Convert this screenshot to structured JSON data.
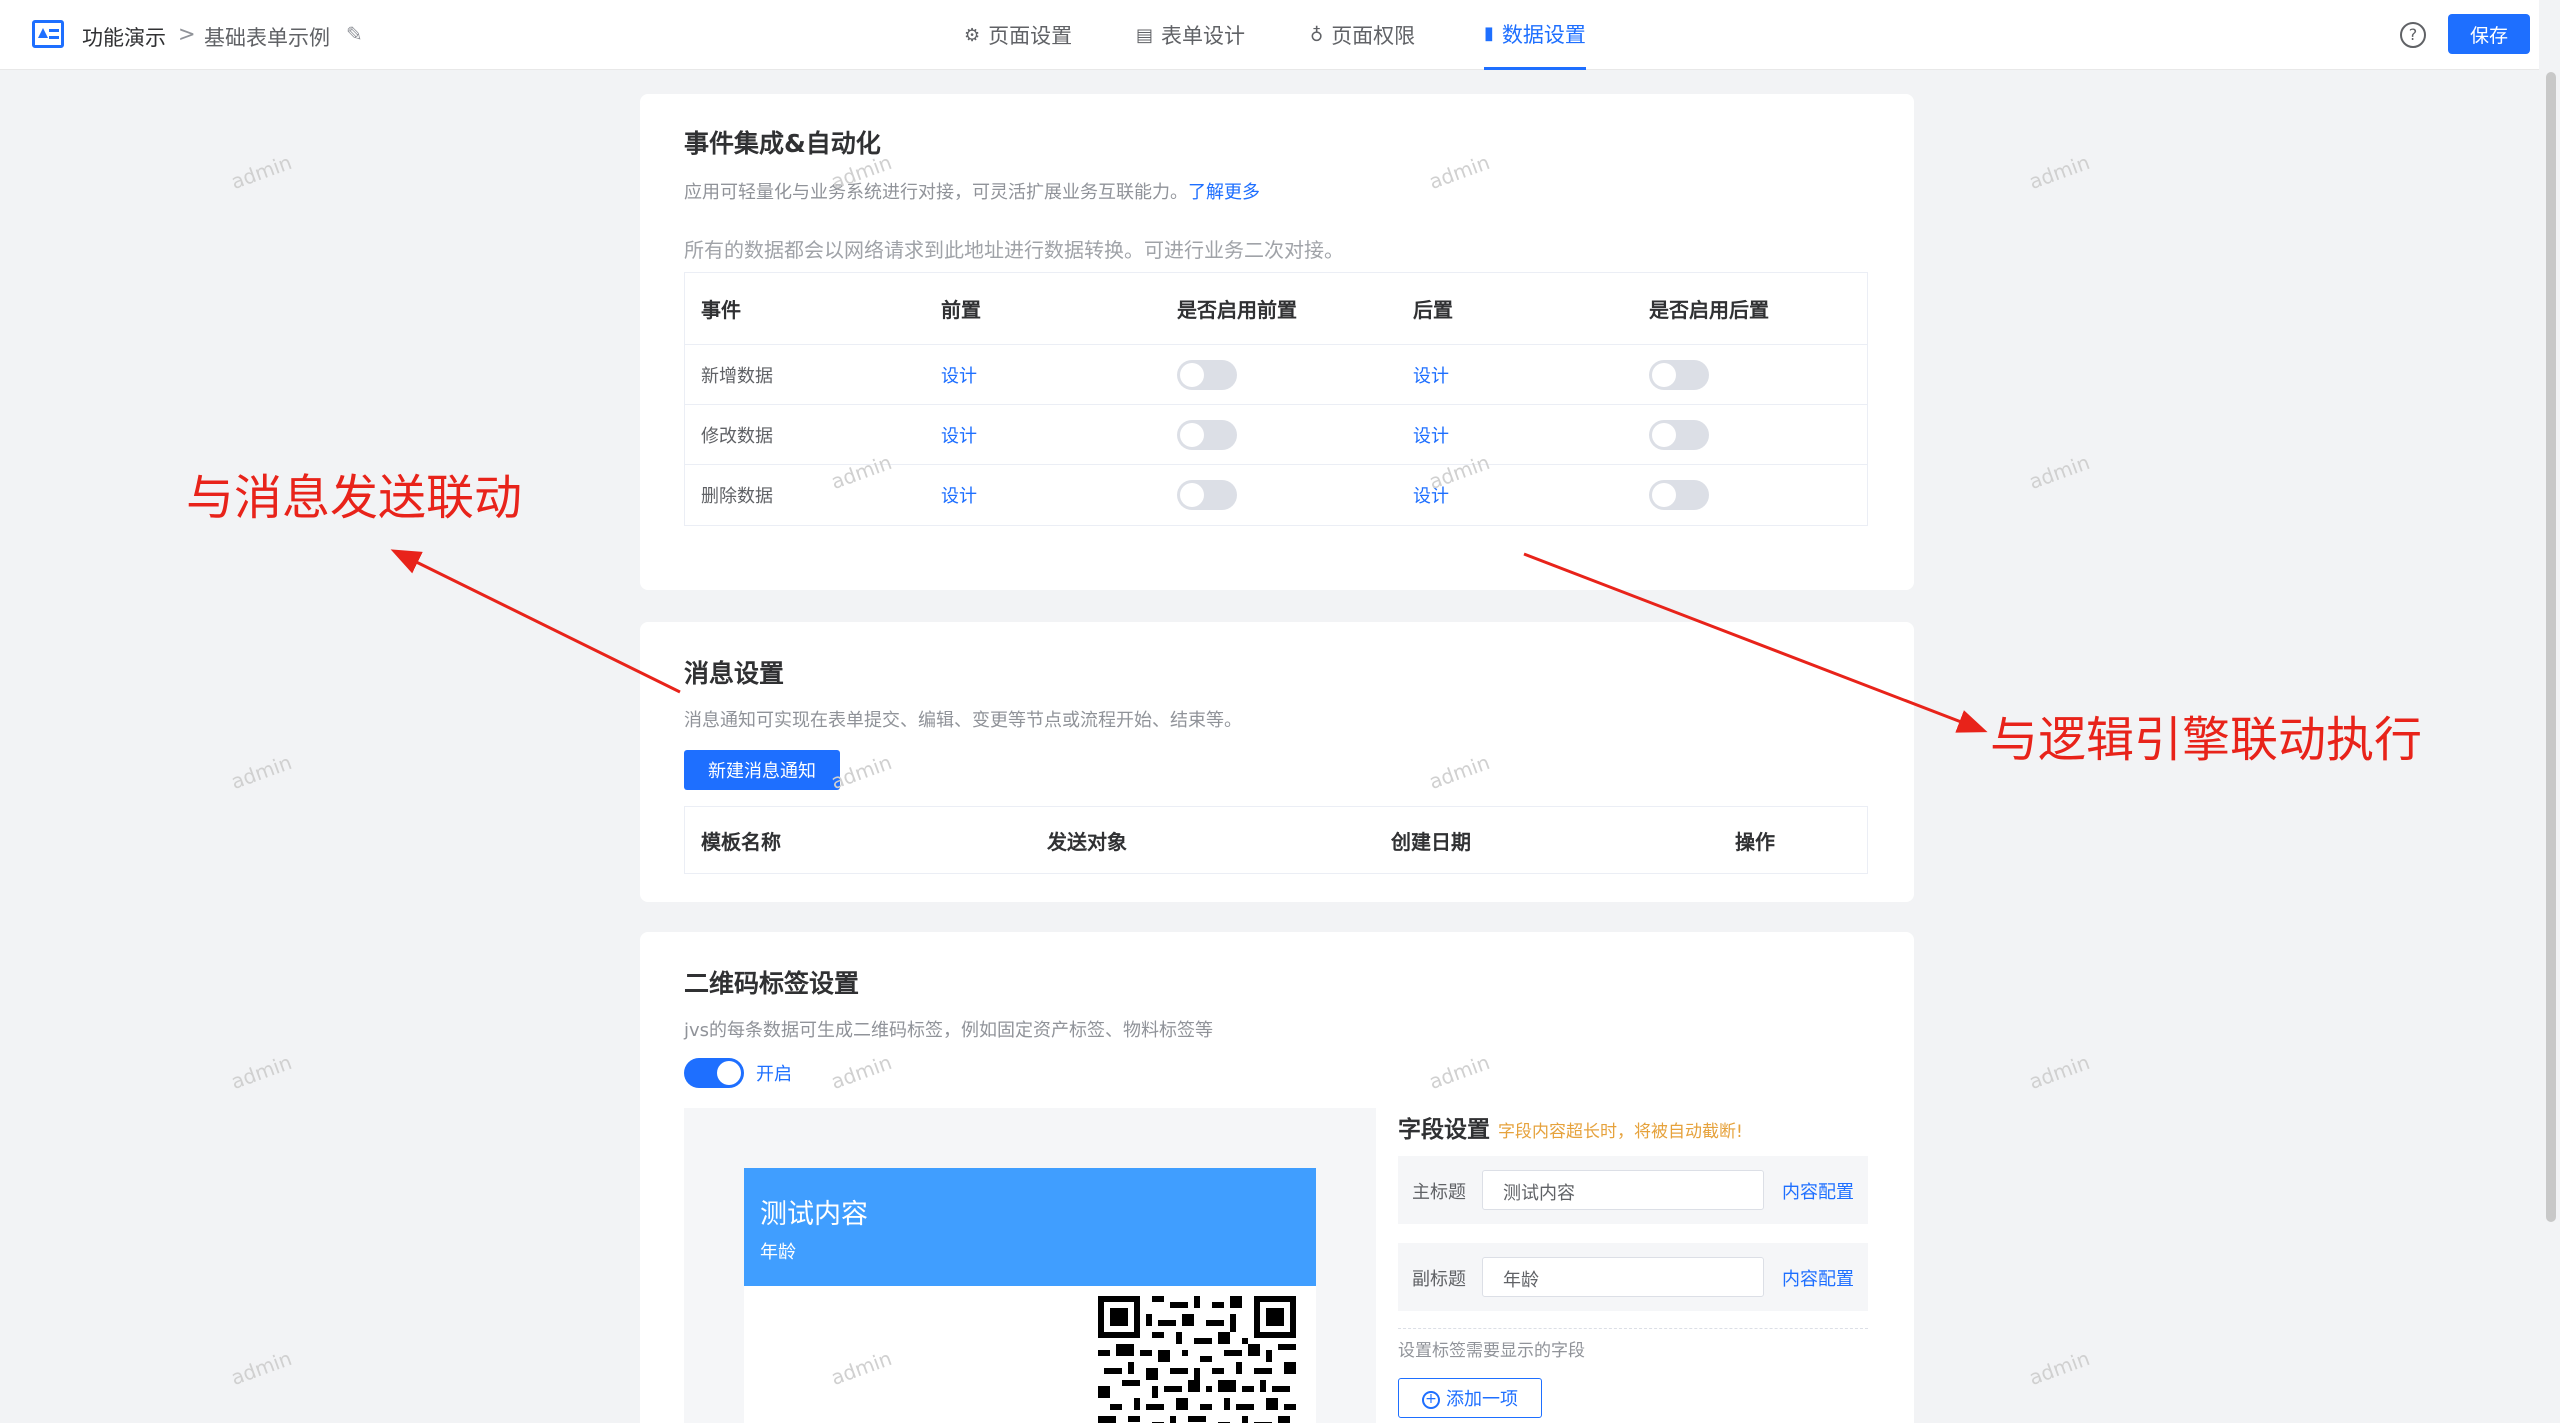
{
  "header": {
    "app_name": "功能演示",
    "separator": ">",
    "page_name": "基础表单示例",
    "tabs": [
      {
        "label": "页面设置",
        "icon": "gear-icon"
      },
      {
        "label": "表单设计",
        "icon": "document-icon"
      },
      {
        "label": "页面权限",
        "icon": "lock-icon"
      },
      {
        "label": "数据设置",
        "icon": "bar-chart-icon",
        "active": true
      }
    ],
    "help_symbol": "?",
    "save_label": "保存"
  },
  "events_card": {
    "title": "事件集成&自动化",
    "description": "应用可轻量化与业务系统进行对接，可灵活扩展业务互联能力。",
    "learn_more": "了解更多",
    "note": "所有的数据都会以网络请求到此地址进行数据转换。可进行业务二次对接。",
    "columns": [
      "事件",
      "前置",
      "是否启用前置",
      "后置",
      "是否启用后置"
    ],
    "rows": [
      {
        "event": "新增数据",
        "pre": "设计",
        "pre_enabled": false,
        "post": "设计",
        "post_enabled": false
      },
      {
        "event": "修改数据",
        "pre": "设计",
        "pre_enabled": false,
        "post": "设计",
        "post_enabled": false
      },
      {
        "event": "删除数据",
        "pre": "设计",
        "pre_enabled": false,
        "post": "设计",
        "post_enabled": false
      }
    ]
  },
  "message_card": {
    "title": "消息设置",
    "description": "消息通知可实现在表单提交、编辑、变更等节点或流程开始、结束等。",
    "new_button": "新建消息通知",
    "columns": [
      "模板名称",
      "发送对象",
      "创建日期",
      "操作"
    ]
  },
  "qr_card": {
    "title": "二维码标签设置",
    "description": "jvs的每条数据可生成二维码标签，例如固定资产标签、物料标签等",
    "enabled": true,
    "toggle_label": "开启",
    "preview": {
      "title": "测试内容",
      "subtitle": "年龄"
    },
    "field_settings": {
      "title": "字段设置",
      "warning": "字段内容超长时，将被自动截断!",
      "fields": [
        {
          "label": "主标题",
          "value": "测试内容",
          "action": "内容配置"
        },
        {
          "label": "副标题",
          "value": "年龄",
          "action": "内容配置"
        }
      ],
      "hint": "设置标签需要显示的字段",
      "add_button": "添加一项"
    }
  },
  "annotations": {
    "left": "与消息发送联动",
    "right": "与逻辑引擎联动执行",
    "color": "#e8231a"
  },
  "watermark": "admin",
  "colors": {
    "primary": "#1e6fff",
    "label_blue": "#409eff",
    "warning": "#e6a23c"
  }
}
